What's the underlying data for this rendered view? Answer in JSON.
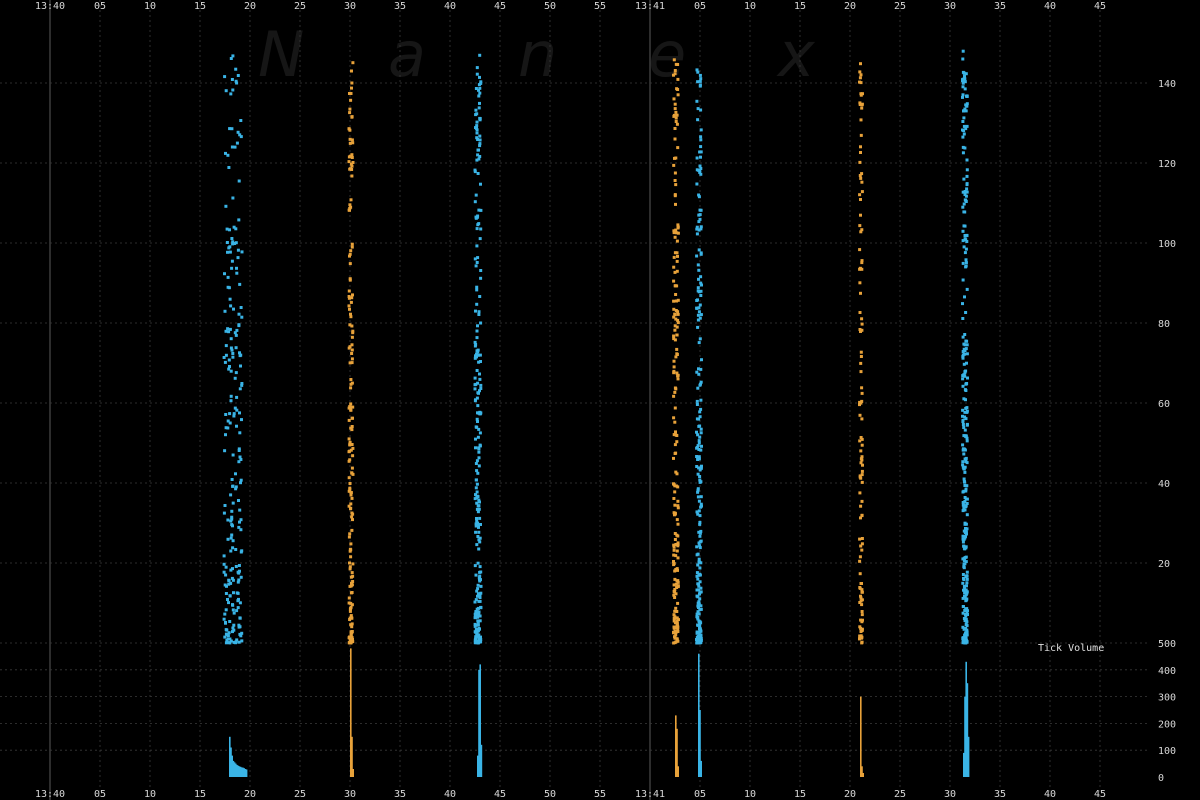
{
  "watermark": "Nanex",
  "colors": {
    "background": "#000000",
    "grid": "#3a3a3a",
    "minute_line": "#5a5a5a",
    "blue": "#3ab4e6",
    "orange": "#e8a23a"
  },
  "chart_data": [
    {
      "type": "scatter",
      "title": "",
      "xlabel": "",
      "ylabel": "",
      "x_unit": "seconds after 13:40",
      "xlim": [
        0,
        110
      ],
      "ylim": [
        0,
        150
      ],
      "grid": true,
      "x_tick_labels": [
        "13:40",
        "05",
        "10",
        "15",
        "20",
        "25",
        "30",
        "35",
        "40",
        "45",
        "50",
        "55",
        "13:41",
        "05",
        "10",
        "15",
        "20",
        "25",
        "30",
        "35",
        "40",
        "45"
      ],
      "x_tick_values": [
        0,
        5,
        10,
        15,
        20,
        25,
        30,
        35,
        40,
        45,
        50,
        55,
        60,
        65,
        70,
        75,
        80,
        85,
        90,
        95,
        100,
        105
      ],
      "y_ticks": [
        20,
        40,
        60,
        80,
        100,
        120,
        140
      ],
      "series": [
        {
          "color": "blue",
          "x_center": 18.3,
          "spread": 0.9,
          "count": 230,
          "y_min": 0,
          "y_max": 148,
          "density": "bottom-heavy"
        },
        {
          "color": "orange",
          "x_center": 30.1,
          "spread": 0.2,
          "count": 180,
          "y_min": 0,
          "y_max": 148,
          "density": "bottom-heavy"
        },
        {
          "color": "blue",
          "x_center": 42.8,
          "spread": 0.3,
          "count": 260,
          "y_min": 0,
          "y_max": 148,
          "density": "bottom-heavy"
        },
        {
          "color": "orange",
          "x_center": 62.6,
          "spread": 0.25,
          "count": 200,
          "y_min": 0,
          "y_max": 146,
          "density": "bottom-heavy"
        },
        {
          "color": "blue",
          "x_center": 64.9,
          "spread": 0.25,
          "count": 240,
          "y_min": 0,
          "y_max": 146,
          "density": "bottom-heavy"
        },
        {
          "color": "orange",
          "x_center": 81.1,
          "spread": 0.15,
          "count": 120,
          "y_min": 0,
          "y_max": 146,
          "density": "bottom-heavy"
        },
        {
          "color": "blue",
          "x_center": 91.5,
          "spread": 0.25,
          "count": 300,
          "y_min": 0,
          "y_max": 148,
          "density": "bottom-heavy"
        }
      ]
    },
    {
      "type": "bar",
      "title": "Tick Volume",
      "xlabel": "",
      "ylabel": "",
      "x_unit": "seconds after 13:40",
      "xlim": [
        0,
        110
      ],
      "ylim": [
        0,
        500
      ],
      "grid": true,
      "y_ticks": [
        0,
        100,
        200,
        300,
        400,
        500
      ],
      "bursts": [
        {
          "color": "blue",
          "x_start": 17.9,
          "bars": [
            150,
            110,
            80,
            60,
            55,
            50,
            45,
            42,
            40,
            38,
            36,
            35,
            33,
            30,
            28
          ]
        },
        {
          "color": "orange",
          "x_start": 30.0,
          "bars": [
            480,
            150,
            30
          ]
        },
        {
          "color": "blue",
          "x_start": 42.7,
          "bars": [
            80,
            400,
            420,
            120
          ]
        },
        {
          "color": "orange",
          "x_start": 62.5,
          "bars": [
            230,
            180,
            40
          ]
        },
        {
          "color": "blue",
          "x_start": 64.8,
          "bars": [
            460,
            250,
            60
          ]
        },
        {
          "color": "orange",
          "x_start": 81.0,
          "bars": [
            300,
            40,
            15
          ]
        },
        {
          "color": "blue",
          "x_start": 91.3,
          "bars": [
            90,
            300,
            430,
            350,
            150
          ]
        }
      ]
    }
  ]
}
